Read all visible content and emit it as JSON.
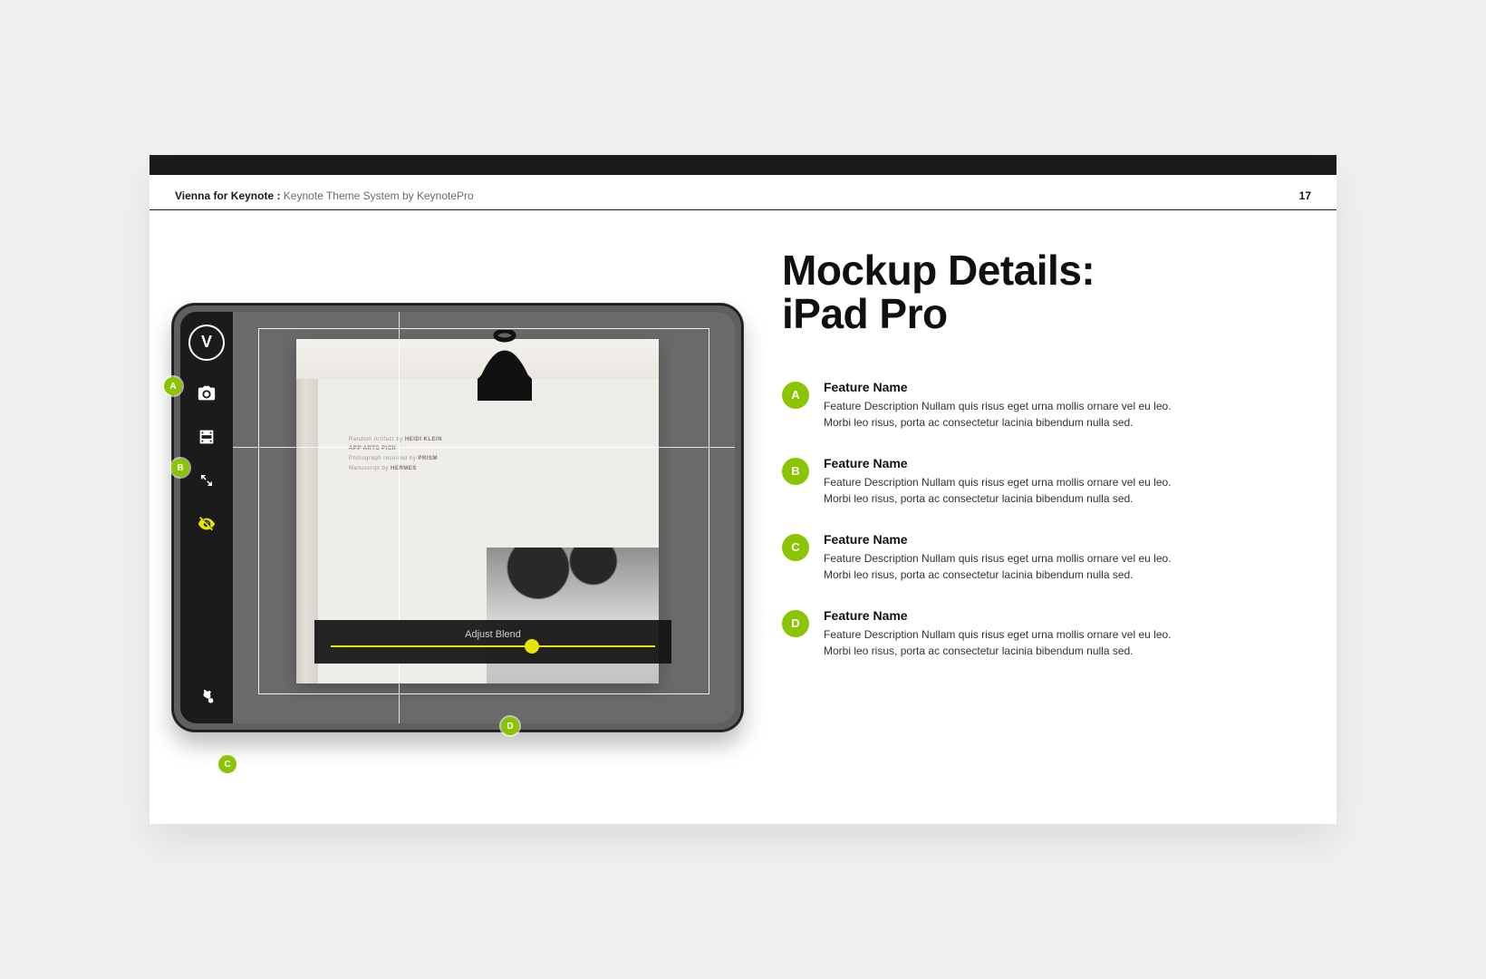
{
  "header": {
    "title_bold": "Vienna for Keynote :",
    "title_light": " Keynote Theme System by KeynotePro",
    "page_number": "17"
  },
  "main": {
    "title_line1": "Mockup Details:",
    "title_line2": "iPad Pro",
    "slider_label": "Adjust Blend"
  },
  "mockup": {
    "logo_letter": "V",
    "microtext_1": "Random Artifact by",
    "microtext_1b": "HEIDI KLEIN",
    "microtext_2": "APP ARTS PICK",
    "microtext_3": "Photograph received by",
    "microtext_3b": "PRISM",
    "microtext_4": "Manuscript by",
    "microtext_4b": "HERMES"
  },
  "markers": {
    "a": "A",
    "b": "B",
    "c": "C",
    "d": "D"
  },
  "features": [
    {
      "badge": "A",
      "name": "Feature Name",
      "desc": "Feature Description Nullam quis risus eget urna mollis ornare vel eu leo. Morbi leo risus, porta ac consectetur lacinia bibendum nulla sed."
    },
    {
      "badge": "B",
      "name": "Feature Name",
      "desc": "Feature Description Nullam quis risus eget urna mollis ornare vel eu leo. Morbi leo risus, porta ac consectetur lacinia bibendum nulla sed."
    },
    {
      "badge": "C",
      "name": "Feature Name",
      "desc": "Feature Description Nullam quis risus eget urna mollis ornare vel eu leo. Morbi leo risus, porta ac consectetur lacinia bibendum nulla sed."
    },
    {
      "badge": "D",
      "name": "Feature Name",
      "desc": "Feature Description Nullam quis risus eget urna mollis ornare vel eu leo. Morbi leo risus, porta ac consectetur lacinia bibendum nulla sed."
    }
  ],
  "colors": {
    "accent_green": "#8bc400",
    "accent_yellow": "#e5e500"
  }
}
